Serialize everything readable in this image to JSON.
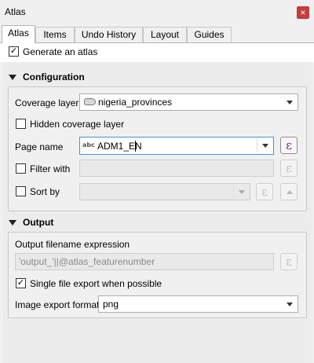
{
  "window": {
    "title": "Atlas",
    "close_glyph": "×"
  },
  "tabs": [
    "Atlas",
    "Items",
    "Undo History",
    "Layout",
    "Guides"
  ],
  "generate_atlas": {
    "label": "Generate an atlas",
    "checked": true
  },
  "configuration": {
    "title": "Configuration",
    "coverage_layer": {
      "label": "Coverage layer",
      "value": "nigeria_provinces",
      "icon": "polygon-layer-icon"
    },
    "hidden_coverage_layer": {
      "label": "Hidden coverage layer",
      "checked": false
    },
    "page_name": {
      "label": "Page name",
      "value": "ADM1_EN",
      "type_icon": "abc"
    },
    "filter_with": {
      "label": "Filter with",
      "checked": false,
      "value": ""
    },
    "sort_by": {
      "label": "Sort by",
      "checked": false,
      "value": ""
    }
  },
  "output": {
    "title": "Output",
    "filename_label": "Output filename expression",
    "filename_value": "'output_'||@atlas_featurenumber",
    "single_file": {
      "label": "Single file export when possible",
      "checked": true
    },
    "image_format": {
      "label": "Image export format",
      "value": "png"
    }
  },
  "icons": {
    "expression": "ε",
    "checkmark": "✓",
    "collapse": "triangle-down-icon"
  }
}
